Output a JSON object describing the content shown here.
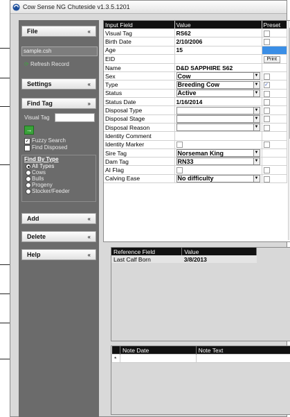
{
  "window": {
    "title": "Cow Sense NG Chuteside v1.3.5.1201"
  },
  "sidebar": {
    "file": {
      "label": "File",
      "chevron": "«",
      "filename": "sample.csh",
      "refresh": "Refresh Record"
    },
    "settings": {
      "label": "Settings",
      "chevron": "«"
    },
    "find_tag": {
      "label": "Find Tag",
      "chevron": "»",
      "visual_tag_label": "Visual Tag",
      "visual_tag_value": "",
      "go_button": "→",
      "fuzzy_search": {
        "label": "Fuzzy Search",
        "checked": true
      },
      "find_disposed": {
        "label": "Find Disposed",
        "checked": false
      },
      "find_by_type": {
        "heading": "Find By Type",
        "options": [
          "All Types",
          "Cows",
          "Bulls",
          "Progeny",
          "Stocker/Feeder"
        ],
        "selected": "All Types"
      }
    },
    "add": {
      "label": "Add",
      "chevron": "«"
    },
    "delete": {
      "label": "Delete",
      "chevron": "«"
    },
    "help": {
      "label": "Help",
      "chevron": "«"
    }
  },
  "main_grid": {
    "headers": [
      "Input Field",
      "Value",
      "Preset"
    ],
    "rows": [
      {
        "field": "Visual Tag",
        "value": "RS62",
        "kind": "text",
        "preset": "unchecked"
      },
      {
        "field": "Birth Date",
        "value": "2/10/2006",
        "kind": "text",
        "preset": "unchecked"
      },
      {
        "field": "Age",
        "value": "15",
        "kind": "text",
        "preset": "blue"
      },
      {
        "field": "EID",
        "value": "",
        "kind": "text",
        "preset": "print"
      },
      {
        "field": "Name",
        "value": "D&D SAPPHIRE S62",
        "kind": "text",
        "preset": "none"
      },
      {
        "field": "Sex",
        "value": "Cow",
        "kind": "dropdown",
        "preset": "unchecked"
      },
      {
        "field": "Type",
        "value": "Breeding Cow",
        "kind": "dropdown",
        "preset": "checked"
      },
      {
        "field": "Status",
        "value": "Active",
        "kind": "dropdown",
        "preset": "unchecked"
      },
      {
        "field": "Status Date",
        "value": "1/16/2014",
        "kind": "text",
        "preset": "unchecked"
      },
      {
        "field": "Disposal Type",
        "value": "",
        "kind": "dropdown",
        "preset": "unchecked"
      },
      {
        "field": "Disposal Stage",
        "value": "",
        "kind": "dropdown",
        "preset": "unchecked"
      },
      {
        "field": "Disposal Reason",
        "value": "",
        "kind": "dropdown",
        "preset": "unchecked"
      },
      {
        "field": "Identity Comment",
        "value": "",
        "kind": "text",
        "preset": "none"
      },
      {
        "field": "Identity Marker",
        "value": "",
        "kind": "checkbox",
        "preset": "unchecked"
      },
      {
        "field": "Sire Tag",
        "value": "Norseman King",
        "kind": "dropdown",
        "preset": "none"
      },
      {
        "field": "Dam Tag",
        "value": "RN33",
        "kind": "dropdown",
        "preset": "none"
      },
      {
        "field": "AI Flag",
        "value": "",
        "kind": "checkbox",
        "preset": "unchecked"
      },
      {
        "field": "Calving Ease",
        "value": "No difficulty",
        "kind": "dropdown",
        "preset": "unchecked"
      }
    ],
    "print_label": "Print",
    "check_glyph": "✓"
  },
  "reference_grid": {
    "headers": [
      "Reference Field",
      "Value"
    ],
    "rows": [
      {
        "field": "Last Calf Born",
        "value": "3/8/2013"
      }
    ]
  },
  "notes_grid": {
    "headers": [
      "",
      "Note Date",
      "Note Text"
    ],
    "new_row_marker": "*"
  },
  "colors": {
    "sidebar": "#6b6b6b",
    "header": "#111111",
    "age_highlight": "#3a8ee6"
  },
  "icons": {
    "app": "cow-sense-icon",
    "refresh": "refresh-icon"
  }
}
